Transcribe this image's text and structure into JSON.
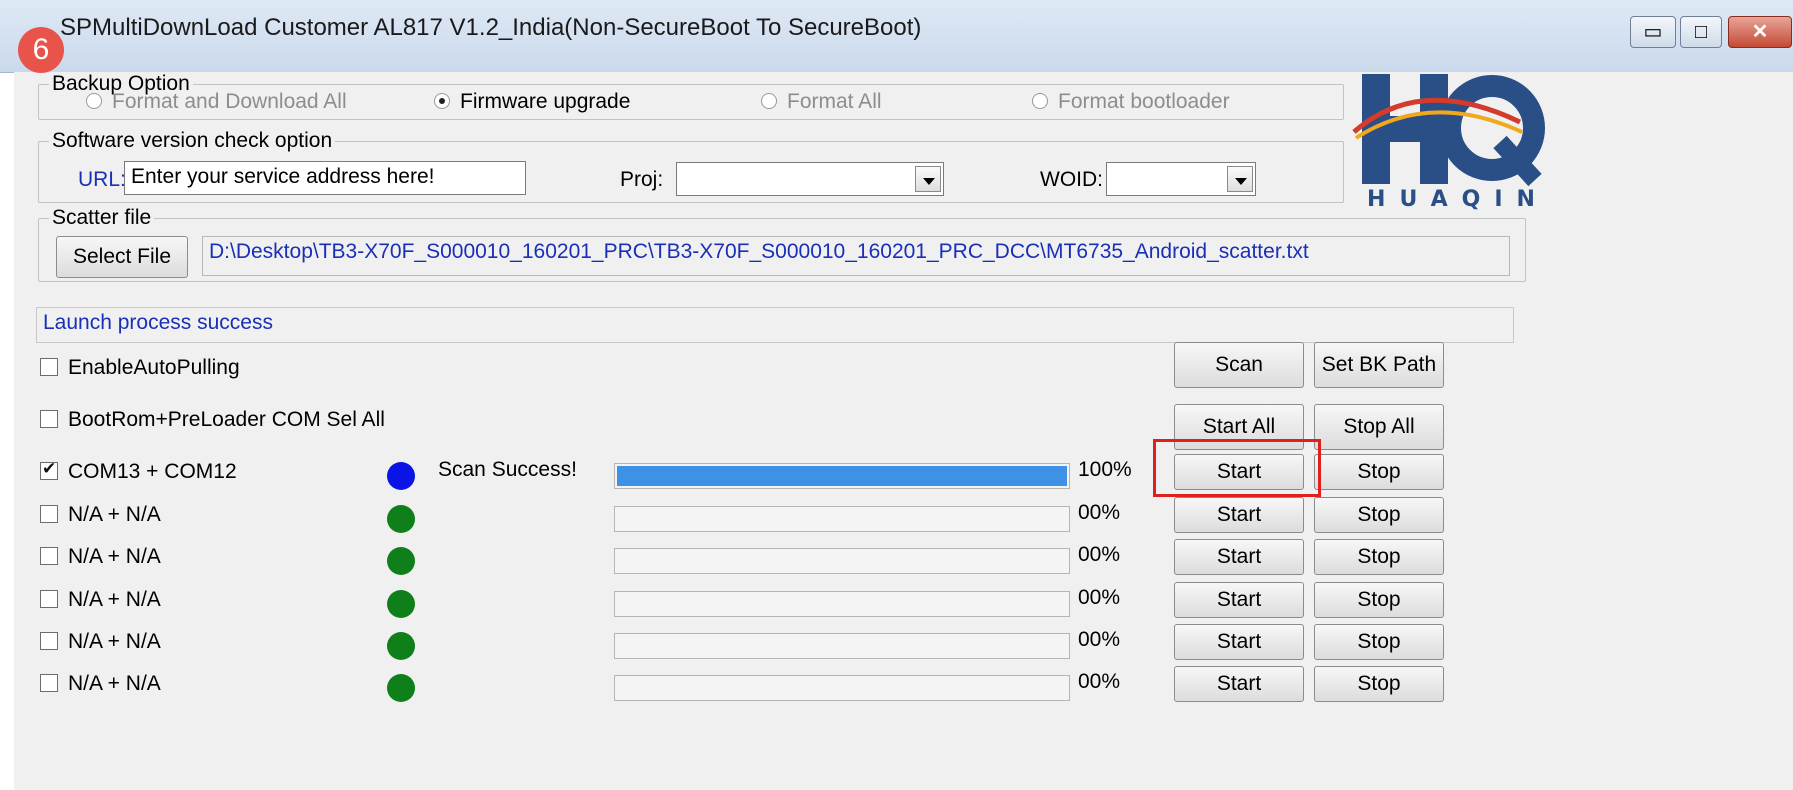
{
  "window": {
    "title": "SPMultiDownLoad Customer AL817 V1.2_India(Non-SecureBoot To SecureBoot)",
    "step_badge": "6",
    "min_glyph": "▭",
    "max_glyph": "□",
    "close_glyph": "✕"
  },
  "backup_option": {
    "legend": "Backup Option",
    "options": [
      {
        "label": "Format and Download All",
        "selected": false,
        "enabled": false
      },
      {
        "label": "Firmware upgrade",
        "selected": true,
        "enabled": true
      },
      {
        "label": "Format All",
        "selected": false,
        "enabled": false
      },
      {
        "label": "Format bootloader",
        "selected": false,
        "enabled": false
      }
    ]
  },
  "version_check": {
    "legend": "Software version check option",
    "url_label": "URL:",
    "url_value": "Enter your service address here!",
    "proj_label": "Proj:",
    "proj_value": "",
    "woid_label": "WOID:",
    "woid_value": ""
  },
  "scatter": {
    "legend": "Scatter file",
    "select_button": "Select File",
    "path": "D:\\Desktop\\TB3-X70F_S000010_160201_PRC\\TB3-X70F_S000010_160201_PRC_DCC\\MT6735_Android_scatter.txt"
  },
  "status": "Launch process success",
  "options": {
    "auto_pulling": {
      "label": "EnableAutoPulling",
      "checked": false
    },
    "com_sel_all": {
      "label": "BootRom+PreLoader COM Sel All",
      "checked": false
    }
  },
  "buttons": {
    "scan": "Scan",
    "set_bk_path": "Set BK Path",
    "start_all": "Start All",
    "stop_all": "Stop All"
  },
  "logo": {
    "text": "HUAQIN"
  },
  "colors": {
    "led_blue": "#0a14e6",
    "led_green": "#0f7f1a",
    "progress_fill": "#3d92e6",
    "highlight": "#e0201c"
  },
  "ports": [
    {
      "label": "COM13 + COM12",
      "checked": true,
      "led": "blue",
      "status": "Scan Success!",
      "progress": 1.0,
      "percent": "100%",
      "start": "Start",
      "stop": "Stop"
    },
    {
      "label": "N/A + N/A",
      "checked": false,
      "led": "green",
      "status": "",
      "progress": 0,
      "percent": "00%",
      "start": "Start",
      "stop": "Stop"
    },
    {
      "label": "N/A + N/A",
      "checked": false,
      "led": "green",
      "status": "",
      "progress": 0,
      "percent": "00%",
      "start": "Start",
      "stop": "Stop"
    },
    {
      "label": "N/A + N/A",
      "checked": false,
      "led": "green",
      "status": "",
      "progress": 0,
      "percent": "00%",
      "start": "Start",
      "stop": "Stop"
    },
    {
      "label": "N/A + N/A",
      "checked": false,
      "led": "green",
      "status": "",
      "progress": 0,
      "percent": "00%",
      "start": "Start",
      "stop": "Stop"
    },
    {
      "label": "N/A + N/A",
      "checked": false,
      "led": "green",
      "status": "",
      "progress": 0,
      "percent": "00%",
      "start": "Start",
      "stop": "Stop"
    }
  ]
}
